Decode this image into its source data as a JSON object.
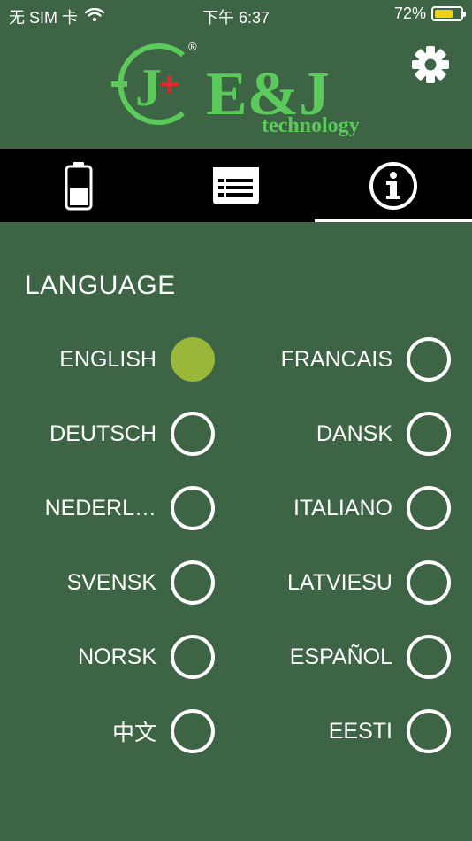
{
  "status_bar": {
    "carrier": "无 SIM 卡",
    "time": "下午 6:37",
    "battery_percent": "72%",
    "battery_level": 0.72,
    "wifi_icon": "wifi-icon"
  },
  "brand": {
    "monogram": "J",
    "name": "E&J",
    "tagline": "technology",
    "registered": "®",
    "color": "#5cc95c",
    "cross_color": "#e3272b"
  },
  "header": {
    "settings_icon": "gear-icon"
  },
  "tabs": [
    {
      "icon": "battery-icon",
      "active": false
    },
    {
      "icon": "list-icon",
      "active": false
    },
    {
      "icon": "info-icon",
      "active": true
    }
  ],
  "language_section": {
    "title": "LANGUAGE",
    "selected_color": "#99b83a",
    "rows": [
      {
        "left": {
          "label": "ENGLISH",
          "selected": true
        },
        "right": {
          "label": "FRANCAIS",
          "selected": false
        }
      },
      {
        "left": {
          "label": "DEUTSCH",
          "selected": false
        },
        "right": {
          "label": "DANSK",
          "selected": false
        }
      },
      {
        "left": {
          "label": "NEDERL…",
          "selected": false
        },
        "right": {
          "label": "ITALIANO",
          "selected": false
        }
      },
      {
        "left": {
          "label": "SVENSK",
          "selected": false
        },
        "right": {
          "label": "LATVIESU",
          "selected": false
        }
      },
      {
        "left": {
          "label": "NORSK",
          "selected": false
        },
        "right": {
          "label": "ESPAÑOL",
          "selected": false
        }
      },
      {
        "left": {
          "label": "中文",
          "selected": false
        },
        "right": {
          "label": "EESTI",
          "selected": false
        }
      }
    ]
  }
}
